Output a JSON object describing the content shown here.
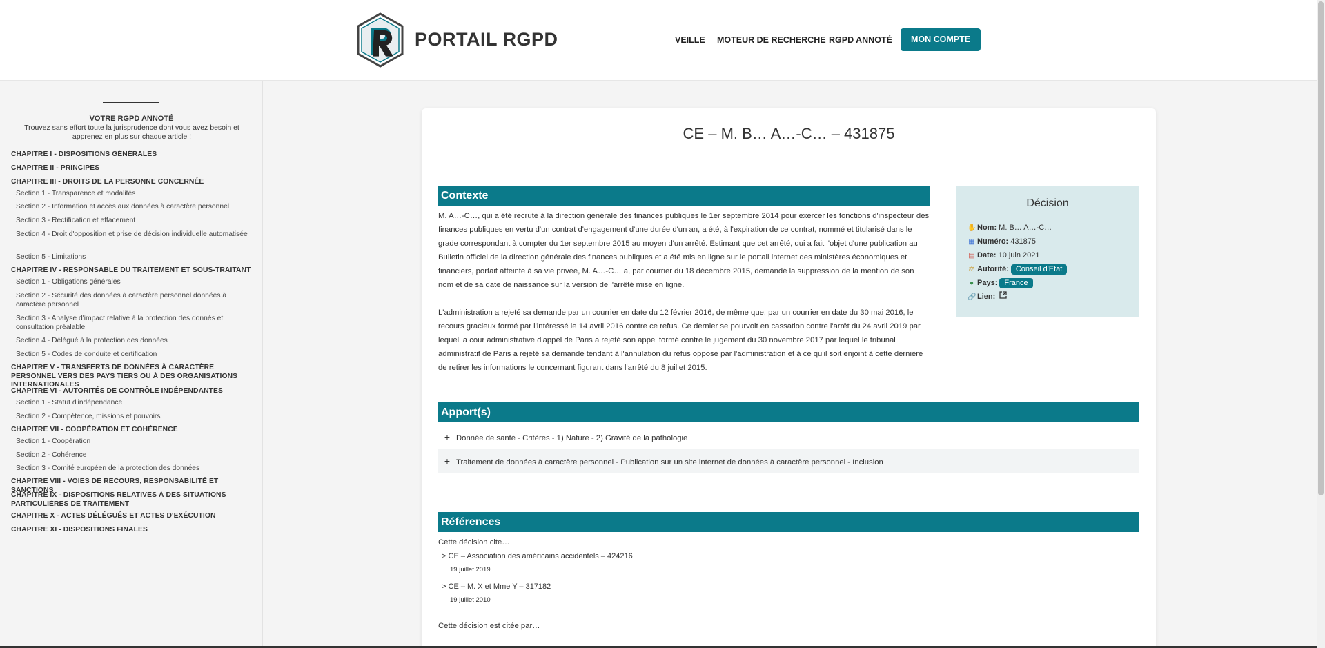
{
  "header": {
    "brand": "PORTAIL RGPD",
    "nav": [
      "VEILLE",
      "MOTEUR DE RECHERCHE",
      "RGPD ANNOTÉ"
    ],
    "account_button": "MON COMPTE",
    "accent_color": "#0b7a8a"
  },
  "sidebar": {
    "title": "VOTRE RGPD ANNOTÉ",
    "subtitle": "Trouvez sans effort toute la jurisprudence dont vous avez besoin et apprenez en plus sur chaque article !",
    "items": [
      {
        "type": "chapter",
        "label": "CHAPITRE I - DISPOSITIONS GÉNÉRALES"
      },
      {
        "type": "chapter",
        "label": "CHAPITRE II - PRINCIPES"
      },
      {
        "type": "chapter",
        "label": "CHAPITRE III - DROITS DE LA PERSONNE CONCERNÉE"
      },
      {
        "type": "section",
        "label": "Section 1 - Transparence et modalités"
      },
      {
        "type": "section",
        "label": "Section 2 - Information et accès aux données à caractère personnel"
      },
      {
        "type": "section",
        "label": "Section 3 - Rectification et effacement"
      },
      {
        "type": "section",
        "label": "Section 4 - Droit d'opposition et prise de décision individuelle automatisée"
      },
      {
        "type": "section",
        "label": "Section 5 - Limitations"
      },
      {
        "type": "chapter",
        "label": "CHAPITRE IV - RESPONSABLE DU TRAITEMENT ET SOUS-TRAITANT"
      },
      {
        "type": "section",
        "label": "Section 1 - Obligations générales"
      },
      {
        "type": "section",
        "label": "Section 2 - Sécurité des données à caractère personnel données à caractère personnel"
      },
      {
        "type": "section",
        "label": "Section 3 - Analyse d'impact relative à la protection des donnés et consultation préalable"
      },
      {
        "type": "section",
        "label": "Section 4 - Délégué à la protection des données"
      },
      {
        "type": "section",
        "label": "Section 5 - Codes de conduite et certification"
      },
      {
        "type": "chapter",
        "label": "CHAPITRE V - TRANSFERTS DE DONNÉES À CARACTÈRE PERSONNEL VERS DES PAYS TIERS OU À DES ORGANISATIONS INTERNATIONALES"
      },
      {
        "type": "chapter",
        "label": "CHAPITRE VI - AUTORITÉS DE CONTRÔLE INDÉPENDANTES"
      },
      {
        "type": "section",
        "label": "Section 1 - Statut d'indépendance"
      },
      {
        "type": "section",
        "label": "Section 2 - Compétence, missions et pouvoirs"
      },
      {
        "type": "chapter",
        "label": "CHAPITRE VII - COOPÉRATION ET COHÉRENCE"
      },
      {
        "type": "section",
        "label": "Section 1 - Coopération"
      },
      {
        "type": "section",
        "label": "Section 2 - Cohérence"
      },
      {
        "type": "section",
        "label": "Section 3 - Comité européen de la protection des données"
      },
      {
        "type": "chapter",
        "label": "CHAPITRE VIII - VOIES DE RECOURS, RESPONSABILITÉ ET SANCTIONS"
      },
      {
        "type": "chapter",
        "label": "CHAPITRE IX - DISPOSITIONS RELATIVES À DES SITUATIONS PARTICULIÈRES DE TRAITEMENT"
      },
      {
        "type": "chapter",
        "label": "CHAPITRE X - ACTES DÉLÉGUÉS ET ACTES D'EXÉCUTION"
      },
      {
        "type": "chapter",
        "label": "CHAPITRE XI - DISPOSITIONS FINALES"
      }
    ]
  },
  "main": {
    "title": "CE – M. B… A…-C… – 431875",
    "contexte": {
      "heading": "Contexte",
      "paragraphs": [
        "M. A…-C…, qui a été recruté à la direction générale des finances publiques le 1er septembre 2014 pour exercer les fonctions d'inspecteur des finances publiques en vertu d'un contrat d'engagement d'une durée d'un an, a été, à l'expiration de ce contrat, nommé et titularisé dans le grade correspondant à compter du 1er septembre 2015 au moyen d'un arrêté. Estimant que cet arrêté, qui a fait l'objet d'une publication au Bulletin officiel de la direction générale des finances publiques et a été mis en ligne sur le portail internet des ministères économiques et financiers, portait atteinte à sa vie privée, M. A…-C… a, par courrier du 18 décembre 2015, demandé la suppression de la mention de son nom et de sa date de naissance sur la version de l'arrêté mise en ligne.",
        "L'administration a rejeté sa demande par un courrier en date du 12 février 2016, de même que, par un courrier en date du 30 mai 2016, le recours gracieux formé par l'intéressé le 14 avril 2016 contre ce refus. Ce dernier se pourvoit en cassation contre l'arrêt du 24 avril 2019 par lequel la cour administrative d'appel de Paris a rejeté son appel formé contre le jugement du 30 novembre 2017 par lequel le tribunal administratif de Paris a rejeté sa demande tendant à l'annulation du refus opposé par l'administration et à ce qu'il soit enjoint à cette dernière de retirer les informations le concernant figurant dans l'arrêté du 8 juillet 2015."
      ]
    },
    "decision": {
      "heading": "Décision",
      "nom_label": "Nom:",
      "nom": "M. B… A…-C…",
      "numero_label": "Numéro:",
      "numero": "431875",
      "date_label": "Date:",
      "date": "10 juin 2021",
      "autorite_label": "Autorité:",
      "autorite": "Conseil d'Etat",
      "pays_label": "Pays:",
      "pays": "France",
      "lien_label": "Lien:"
    },
    "apports": {
      "heading": "Apport(s)",
      "items": [
        "Donnée de santé - Critères - 1) Nature - 2) Gravité de la pathologie",
        "Traitement de données à caractère personnel - Publication sur un site internet de données à caractère personnel - Inclusion"
      ]
    },
    "references": {
      "heading": "Références",
      "cites_label": "Cette décision cite…",
      "cites": [
        {
          "title": "CE – Association des américains accidentels – 424216",
          "date": "19 juillet 2019"
        },
        {
          "title": "CE – M. X et Mme Y – 317182",
          "date": "19 juillet 2010"
        }
      ],
      "cited_by_label": "Cette décision est citée par…"
    }
  }
}
